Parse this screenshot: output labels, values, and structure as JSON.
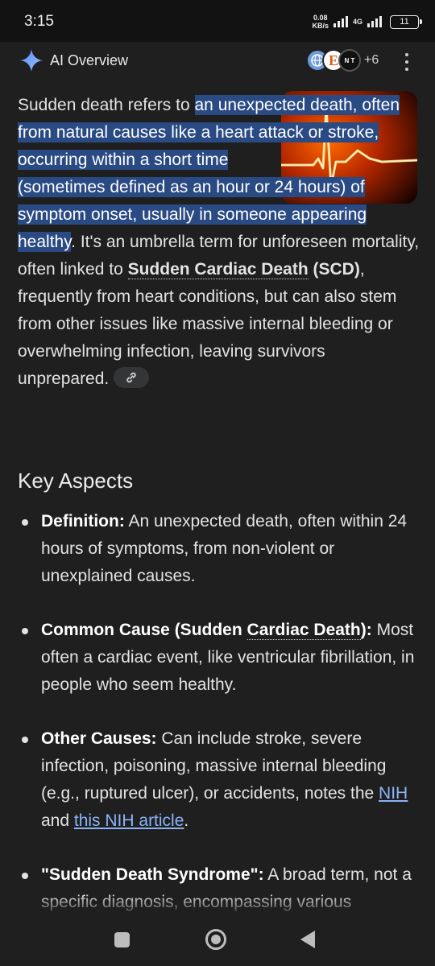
{
  "status_bar": {
    "time": "3:15",
    "net_speed_value": "0.08",
    "net_speed_unit": "KB/s",
    "network_type": "4G",
    "battery": "11"
  },
  "header": {
    "title": "AI Overview",
    "source_more": "+6",
    "source_icons": [
      "globe-logo-icon",
      "e-logo-icon",
      "nt-logo-icon"
    ],
    "source_nt_text": "N T"
  },
  "overview": {
    "intro": "Sudden death refers to ",
    "highlight_1": "an unexpected death, often from natural causes like a heart attack or stroke, occurring within a short time",
    "highlight_2": "(sometimes defined as an hour or 24 hours) of symptom onset, usually in someone appearing healthy",
    "text_after_highlight": ". It's an umbrella term for unforeseen mortality, often linked to ",
    "scd_term": "Sudden Cardiac Death",
    "scd_abbr": " (SCD)",
    "text_end": ", frequently from heart conditions, but can also stem from other issues like massive internal bleeding or overwhelming infection, leaving survivors unprepared. "
  },
  "key_aspects": {
    "title": "Key Aspects",
    "items": [
      {
        "label": "Definition:",
        "text": " An unexpected death, often within 24 hours of symptoms, from non-violent or unexplained causes."
      },
      {
        "label_pre": "Common Cause (Sudden ",
        "label_term": "Cardiac Death",
        "label_post": "):",
        "text": " Most often a cardiac event, like ventricular fibrillation, in people who seem healthy."
      },
      {
        "label": "Other Causes:",
        "text": " Can include stroke, severe infection, poisoning, massive internal bleeding (e.g., ruptured ulcer), or accidents, notes the ",
        "link_1": "NIH",
        "and": " and ",
        "link_2": "this NIH article",
        "end": "."
      },
      {
        "label": "\"Sudden Death Syndrome\":",
        "text": " A broad term, not a specific diagnosis, encompassing various scenarios leading to quick, unforeseen death, sometimes with no clear cause even after"
      }
    ]
  },
  "colors": {
    "background": "#1f1f1f",
    "highlight": "#2a4a83",
    "link": "#8ab4f8"
  }
}
